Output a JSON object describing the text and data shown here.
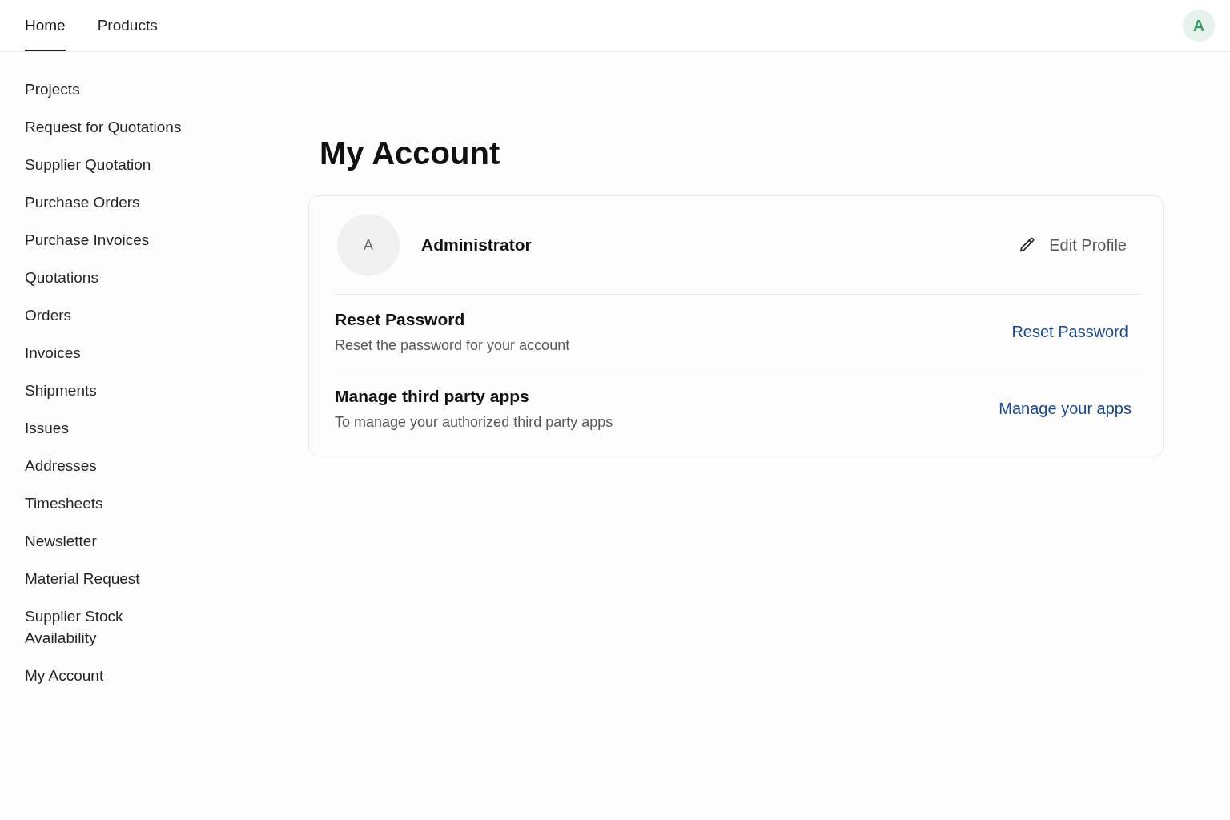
{
  "navbar": {
    "tabs": [
      {
        "label": "Home",
        "selected": true
      },
      {
        "label": "Products",
        "selected": false
      }
    ],
    "user_avatar": "A"
  },
  "sidebar": {
    "items": [
      "Projects",
      "Request for Quotations",
      "Supplier Quotation",
      "Purchase Orders",
      "Purchase Invoices",
      "Quotations",
      "Orders",
      "Invoices",
      "Shipments",
      "Issues",
      "Addresses",
      "Timesheets",
      "Newsletter",
      "Material Request",
      "Supplier Stock Availability",
      "My Account"
    ]
  },
  "page_title": "My Account",
  "profile_card": {
    "avatar": "A",
    "name": "Administrator",
    "edit_button": "Edit Profile",
    "sections": [
      {
        "title": "Reset Password",
        "description": "Reset the password for your account",
        "action": "Reset Password"
      },
      {
        "title": "Manage third party apps",
        "description": "To manage your authorized third party apps",
        "action": "Manage your apps"
      }
    ]
  }
}
